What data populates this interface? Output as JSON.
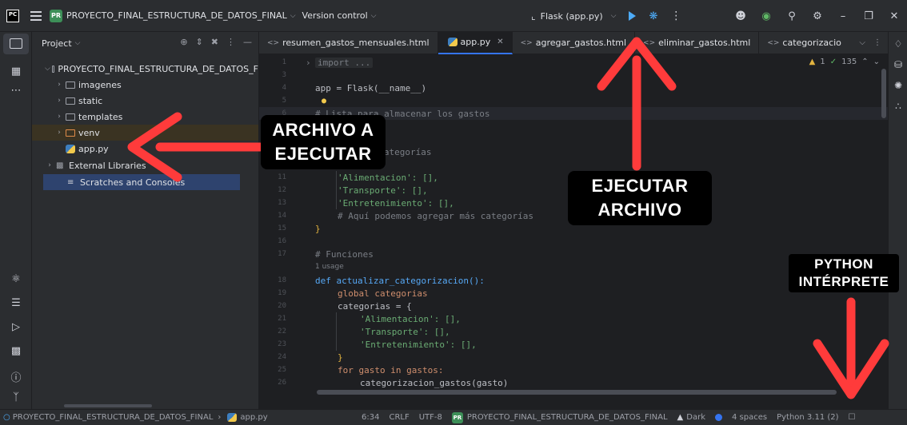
{
  "titlebar": {
    "logo": "PC",
    "project_badge": "PR",
    "project_name": "PROYECTO_FINAL_ESTRUCTURA_DE_DATOS_FINAL",
    "vcs_label": "Version control",
    "run_config": "Flask (app.py)"
  },
  "project_panel": {
    "title": "Project",
    "root": "PROYECTO_FINAL_ESTRUCTURA_DE_DATOS_F",
    "items": [
      {
        "label": "imagenes"
      },
      {
        "label": "static"
      },
      {
        "label": "templates"
      },
      {
        "label": "venv"
      },
      {
        "label": "app.py"
      },
      {
        "label": "External Libraries"
      },
      {
        "label": "Scratches and Consoles"
      }
    ]
  },
  "tabs": [
    {
      "label": "resumen_gastos_mensuales.html"
    },
    {
      "label": "app.py"
    },
    {
      "label": "agregar_gastos.html"
    },
    {
      "label": "eliminar_gastos.html"
    },
    {
      "label": "categorizacio"
    }
  ],
  "editor": {
    "warnings": "1",
    "checks": "135",
    "usage_hint": "1 usage",
    "lines": [
      {
        "n": "1",
        "text": "import ..."
      },
      {
        "n": "3",
        "text": ""
      },
      {
        "n": "4",
        "text": "app = Flask(__name__)"
      },
      {
        "n": "5",
        "text": ""
      },
      {
        "n": "6",
        "text": "# Lista para almacenar los gastos"
      },
      {
        "n": "9",
        "text": "a categorías"
      },
      {
        "n": "11",
        "text": "'Alimentacion': [],"
      },
      {
        "n": "12",
        "text": "'Transporte': [],"
      },
      {
        "n": "13",
        "text": "'Entretenimiento': [],"
      },
      {
        "n": "14",
        "text": "# Aquí podemos agregar más categorías"
      },
      {
        "n": "15",
        "text": "}"
      },
      {
        "n": "16",
        "text": ""
      },
      {
        "n": "17",
        "text": "# Funciones"
      },
      {
        "n": "18",
        "text": "def actualizar_categorizacion():"
      },
      {
        "n": "19",
        "text": "global categorias"
      },
      {
        "n": "20",
        "text": "categorias = {"
      },
      {
        "n": "21",
        "text": "'Alimentacion': [],"
      },
      {
        "n": "22",
        "text": "'Transporte': [],"
      },
      {
        "n": "23",
        "text": "'Entretenimiento': [],"
      },
      {
        "n": "24",
        "text": "}"
      },
      {
        "n": "25",
        "text": "for gasto in gastos:"
      },
      {
        "n": "26",
        "text": "categorizacion_gastos(gasto)"
      }
    ]
  },
  "statusbar": {
    "breadcrumb_project": "PROYECTO_FINAL_ESTRUCTURA_DE_DATOS_FINAL",
    "breadcrumb_file": "app.py",
    "position": "6:34",
    "line_sep": "CRLF",
    "encoding": "UTF-8",
    "badge": "PR",
    "project": "PROYECTO_FINAL_ESTRUCTURA_DE_DATOS_FINAL",
    "theme": "Dark",
    "indent": "4 spaces",
    "interpreter": "Python 3.11 (2)"
  },
  "annotations": {
    "file_line1": "ARCHIVO A",
    "file_line2": "EJECUTAR",
    "run_line1": "EJECUTAR",
    "run_line2": "ARCHIVO",
    "interp_line1": "PYTHON",
    "interp_line2": "INTÉRPRETE",
    "arrow_color": "#ff3b3b"
  }
}
